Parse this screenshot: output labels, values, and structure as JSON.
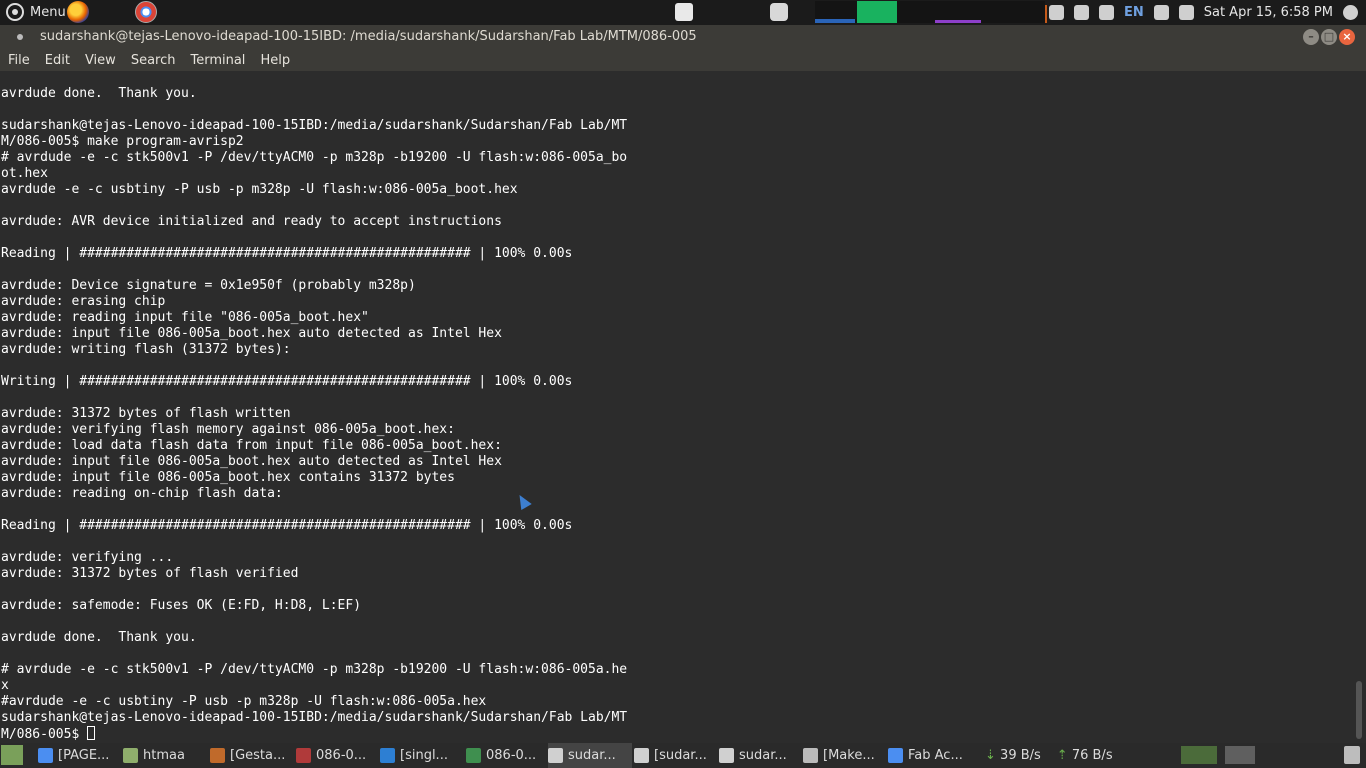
{
  "top_panel": {
    "menu_label": "Menu",
    "tray": {
      "keyboard_layout": "EN",
      "datetime": "Sat Apr 15,  6:58 PM"
    }
  },
  "window": {
    "title": "sudarshank@tejas-Lenovo-ideapad-100-15IBD: /media/sudarshank/Sudarshan/Fab Lab/MTM/086-005"
  },
  "menubar": {
    "items": [
      "File",
      "Edit",
      "View",
      "Search",
      "Terminal",
      "Help"
    ]
  },
  "terminal": {
    "lines": [
      "avrdude done.  Thank you.",
      "",
      "sudarshank@tejas-Lenovo-ideapad-100-15IBD:/media/sudarshank/Sudarshan/Fab Lab/MT",
      "M/086-005$ make program-avrisp2",
      "# avrdude -e -c stk500v1 -P /dev/ttyACM0 -p m328p -b19200 -U flash:w:086-005a_bo",
      "ot.hex",
      "avrdude -e -c usbtiny -P usb -p m328p -U flash:w:086-005a_boot.hex",
      "",
      "avrdude: AVR device initialized and ready to accept instructions",
      "",
      "Reading | ################################################## | 100% 0.00s",
      "",
      "avrdude: Device signature = 0x1e950f (probably m328p)",
      "avrdude: erasing chip",
      "avrdude: reading input file \"086-005a_boot.hex\"",
      "avrdude: input file 086-005a_boot.hex auto detected as Intel Hex",
      "avrdude: writing flash (31372 bytes):",
      "",
      "Writing | ################################################## | 100% 0.00s",
      "",
      "avrdude: 31372 bytes of flash written",
      "avrdude: verifying flash memory against 086-005a_boot.hex:",
      "avrdude: load data flash data from input file 086-005a_boot.hex:",
      "avrdude: input file 086-005a_boot.hex auto detected as Intel Hex",
      "avrdude: input file 086-005a_boot.hex contains 31372 bytes",
      "avrdude: reading on-chip flash data:",
      "",
      "Reading | ################################################## | 100% 0.00s",
      "",
      "avrdude: verifying ...",
      "avrdude: 31372 bytes of flash verified",
      "",
      "avrdude: safemode: Fuses OK (E:FD, H:D8, L:EF)",
      "",
      "avrdude done.  Thank you.",
      "",
      "# avrdude -e -c stk500v1 -P /dev/ttyACM0 -p m328p -b19200 -U flash:w:086-005a.he",
      "x",
      "#avrdude -e -c usbtiny -P usb -p m328p -U flash:w:086-005a.hex",
      "sudarshank@tejas-Lenovo-ideapad-100-15IBD:/media/sudarshank/Sudarshan/Fab Lab/MT"
    ],
    "prompt_line": "M/086-005$ "
  },
  "taskbar": {
    "tasks": [
      {
        "label": "[PAGE...",
        "icon": "chrome-icon",
        "color": "#4b8ef1"
      },
      {
        "label": "htmaa",
        "icon": "folder-icon",
        "color": "#8fae6c"
      },
      {
        "label": "[Gesta...",
        "icon": "e-editor-icon",
        "color": "#c06a2b"
      },
      {
        "label": "086-0...",
        "icon": "kicad-sch-icon",
        "color": "#b03a3a"
      },
      {
        "label": "[singl...",
        "icon": "vscode-icon",
        "color": "#2d7fd3"
      },
      {
        "label": "086-0...",
        "icon": "kicad-brd-icon",
        "color": "#3f8f4f"
      },
      {
        "label": "sudar...",
        "icon": "terminal-icon",
        "color": "#d0d0d0"
      },
      {
        "label": "[sudar...",
        "icon": "terminal-icon",
        "color": "#d0d0d0"
      },
      {
        "label": "sudar...",
        "icon": "terminal-icon",
        "color": "#d0d0d0"
      },
      {
        "label": "[Make...",
        "icon": "text-editor-icon",
        "color": "#bbbbbb"
      },
      {
        "label": "Fab Ac...",
        "icon": "chrome-icon",
        "color": "#4b8ef1"
      }
    ],
    "download_speed": "39 B/s",
    "upload_speed": "76 B/s"
  }
}
